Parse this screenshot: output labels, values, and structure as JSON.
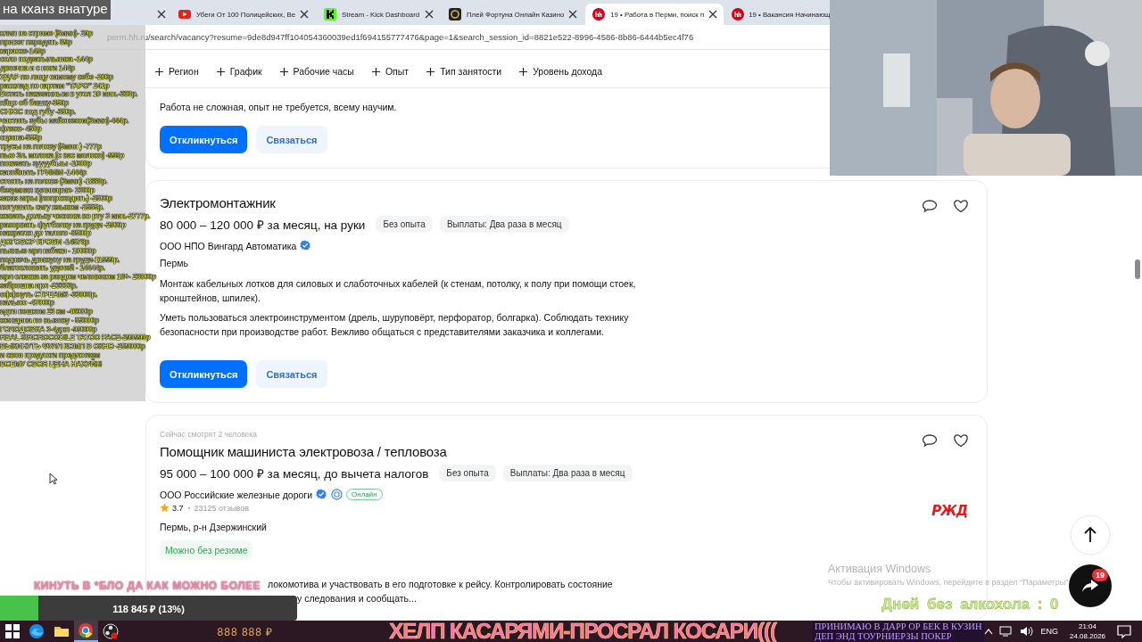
{
  "browser": {
    "tabs": [
      {
        "kind": "none",
        "closable": true,
        "selected": false
      },
      {
        "kind": "video",
        "title": "Убеги От 100 Полицейских, Ве",
        "closable": true,
        "selected": false
      },
      {
        "kind": "kick",
        "title": "Stream - Kick Dashboard",
        "closable": true,
        "selected": false
      },
      {
        "kind": "casino",
        "title": "Плей Фортуна Онлайн Казино",
        "closable": true,
        "selected": false
      },
      {
        "kind": "hh",
        "title": "19 • Работа в Перми, поиск п",
        "closable": true,
        "selected": true
      },
      {
        "kind": "hh",
        "title": "19 • Вакансия Начинающ",
        "closable": false,
        "selected": false
      }
    ],
    "address": "perm.hh.ru/search/vacancy?resume=9de8d947ff104054360039ed1f694155777476&page=1&search_session_id=8821e522-8996-4586-8b86-6444b5ec4f76"
  },
  "filters": [
    "Регион",
    "График",
    "Рабочие часы",
    "Опыт",
    "Тип занятости",
    "Уровень дохода"
  ],
  "vacancies": [
    {
      "kind": "cut",
      "description": [
        "Работа не сложная, опыт не требуется, всему научим."
      ],
      "buttons": [
        "Откликнуться",
        "Связаться"
      ]
    },
    {
      "kind": "full",
      "title": "Электромонтажник",
      "salary": "80 000 – 120 000 ₽ за месяц, на руки",
      "tags": [
        "Без опыта",
        "Выплаты: Два раза в месяц"
      ],
      "company": "ООО НПО Вингард Автоматика",
      "verified": true,
      "location": "Пермь",
      "description": [
        "Монтаж кабельных лотков для силовых и слаботочных кабелей (к стенам, потолку, к полу при помощи стоек, кронштейнов, шпилек).",
        "Уметь пользоваться электроинструментом (дрель, шуруповёрт, перфоратор, болгарка). Соблюдать технику безопасности при производстве работ. Вежливо общаться с представителями заказчика и коллегами."
      ],
      "buttons": [
        "Откликнуться",
        "Связаться"
      ]
    },
    {
      "kind": "full",
      "viewers": "Сейчас смотрят 2 человека",
      "title": "Помощник машиниста электровоза / тепловоза",
      "salary": "95 000 – 100 000 ₽ за месяц, до вычета налогов",
      "tags": [
        "Без опыта",
        "Выплаты: Два раза в месяц"
      ],
      "company": "ООО Российские железные дороги",
      "verified": true,
      "accredited": true,
      "online": "Онлайн",
      "rating": "3.7",
      "reviews": "23125 отзывов",
      "location": "Пермь, р-н Дзержинский",
      "chip": "Можно без резюме",
      "logo": "РЖД",
      "description_fragments": [
        "локомотива и участвовать в его подготовке к рейсу. Контролировать состояние",
        "у следования и сообщать..."
      ]
    }
  ],
  "stream": {
    "title": "на кханз внатуре",
    "price_list": [
      "клип на стриме (5мин)- 29р",
      "привет передать 89р",
      "караоке-149р",
      "соло подзатыльника -144р",
      "двоечка и с ноги 144р",
      "УДАР по лицу самому себе -200р",
      "расклад по картам \"ТАРО\" 241р",
      "Встать наказанным в угол 10 мин.-333р.",
      "яйцо об башку-350р",
      "СНЮС под губу -350р.",
      "чистить зубы майонезом(3мин)-444р.",
      "флекс- 450р",
      "сценка-555р",
      "трусы на голову (5мин ) -777р",
      "пью 3л. молока (с вас молоко) -999р",
      "показать зуууубыы -1000р",
      "какойнить ГРИММ -1444р",
      "стоять на голове (3мин) -1888р.",
      "безумная кулинария- 2300р",
      "заказ игры (попроходить) -2500р",
      "потушить сигу языком -2555р.",
      "жевать дольку чеснока во рту 3 мин.-2777р.",
      "разорвать футболку на груди -2900р",
      "нажратся до талого -8500р",
      "ДОГОВОР КРОВИ -14578р",
      "пьяные ирл кабаки - 10000р",
      "поджечь движуху на груди-11999р.",
      "благословить удачей - 14444р.",
      "ирл слежка за рандом человеком 18+- 23000р",
      "заброшка ирл -23333р.",
      "оффнуть СТРЕАМ3 -33000р.",
      "налысо -47000р",
      "идти пешком 23 км -46000р",
      "женщина по вызову - 55000р",
      "ГОЛОДОВКА 3-4дня -99000р",
      "REAL SIRCROCODILE TATOO FACE-299999р",
      "ВЫКИНУТЬ ФУЛЛ КОМП В ОКНО -259000р",
      "и свои предлоги предлогаем",
      "ВСЕМУ СВОЯ ЦЕНА НАХУЙ!!!"
    ],
    "goal_caption": "КИНУТЬ В *БЛО ДА КАК МОЖНО БОЛЕЕ",
    "goal": {
      "reading": "118 845 ₽ (13%)",
      "level": 0.13
    },
    "total": "888 888 ₽",
    "banner": "ХЕЛП КАСАРЯМИ-ПРОСРАЛ КОСАРИ(((",
    "ticker": [
      "ПРИНИМАЮ В ДАРР ОР БЕК В КУЗИН",
      "ДЕП ЭНД ТОУРНИЕРЗЫ ПОКЕР"
    ],
    "sober_days": "Дней без алкохола : 0"
  },
  "activation": {
    "title": "Активация Windows",
    "text": "Чтобы активировать Windows, перейдите в раздел \"Параметры\""
  },
  "chat_badge": "19",
  "taskbar": {
    "apps": [
      {
        "kind": "start",
        "active": false
      },
      {
        "kind": "edge",
        "active": false
      },
      {
        "kind": "folder",
        "active": false
      },
      {
        "kind": "chrome",
        "active": true
      },
      {
        "kind": "obs",
        "active": false
      }
    ],
    "language": "ENG",
    "time": "21:04",
    "date": "24.08.2026"
  }
}
